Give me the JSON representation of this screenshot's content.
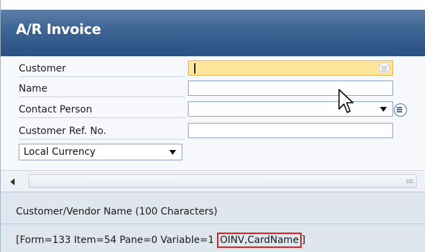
{
  "window": {
    "title": "A/R Invoice"
  },
  "form": {
    "fields": [
      {
        "label": "Customer",
        "value": "",
        "state": "active"
      },
      {
        "label": "Name",
        "value": ""
      },
      {
        "label": "Contact Person",
        "value": ""
      },
      {
        "label": "Customer Ref. No.",
        "value": ""
      }
    ],
    "currency_select": {
      "selected": "Local Currency"
    }
  },
  "status": {
    "description": "Customer/Vendor Name (100 Characters)",
    "debug_prefix": "[Form=133 Item=54 Pane=0 Variable=1 ",
    "debug_highlight": "OINV,CardName",
    "debug_suffix": "]"
  },
  "colors": {
    "title_bar": "#2c5283",
    "active_field": "#ffe69a",
    "highlight_box": "#e21b1b"
  },
  "icons": [
    "link-arrow-icon",
    "dropdown-arrow-icon",
    "scroll-left-icon",
    "mouse-pointer-icon"
  ]
}
